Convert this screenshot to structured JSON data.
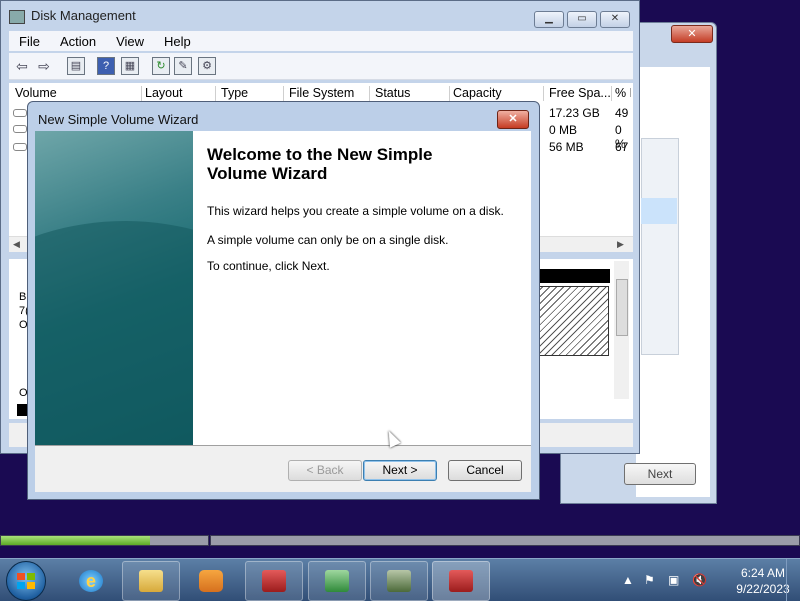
{
  "colors": {
    "desktop": "#1a0a52",
    "wizard_accent": "#186a70",
    "progress_green": "#5caa26"
  },
  "background_window": {
    "next_label": "Next"
  },
  "disk_management": {
    "title": "Disk Management",
    "menu": [
      "File",
      "Action",
      "View",
      "Help"
    ],
    "columns": [
      "Volume",
      "Layout",
      "Type",
      "File System",
      "Status",
      "Capacity",
      "Free Spa...",
      "% F"
    ],
    "free_space": [
      "17.23 GB",
      "0 MB",
      "56 MB"
    ],
    "percent_free": [
      "49",
      "0 %",
      "67"
    ],
    "lower_pane_text": [
      "B",
      "7(",
      "O",
      "O"
    ]
  },
  "wizard": {
    "title": "New Simple Volume Wizard",
    "heading_line1": "Welcome to the New Simple",
    "heading_line2": "Volume Wizard",
    "para1": "This wizard helps you create a simple volume on a disk.",
    "para2": "A simple volume can only be on a single disk.",
    "para3": "To continue, click Next.",
    "back_label": "< Back",
    "next_label": "Next >",
    "cancel_label": "Cancel"
  },
  "progress": {
    "left_fill_fraction": 0.72,
    "right_fill_fraction": 0.0
  },
  "taskbar": {
    "items": [
      "start-button",
      "internet-explorer",
      "windows-explorer",
      "media-player",
      "toolbox-app",
      "disk-install-app",
      "computer-management",
      "toolbox-app-active"
    ],
    "time": "6:24 AM",
    "date": "9/22/2023"
  }
}
